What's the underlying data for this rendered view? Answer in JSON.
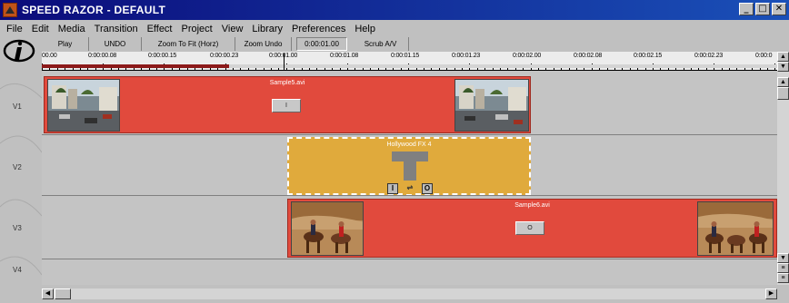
{
  "window": {
    "title": "SPEED RAZOR - DEFAULT",
    "controls": [
      "_",
      "□",
      "✕"
    ]
  },
  "menu": [
    "File",
    "Edit",
    "Media",
    "Transition",
    "Effect",
    "Project",
    "View",
    "Library",
    "Preferences",
    "Help"
  ],
  "toolbar": {
    "play": "Play",
    "undo": "UNDO",
    "zoom_fit": "Zoom To Fit (Horz)",
    "zoom_undo": "Zoom Undo",
    "timecode": "0:00:01.00",
    "scrub": "Scrub A/V"
  },
  "ruler": {
    "labels": [
      "00.00",
      "0:00:00.08",
      "0:00:00.15",
      "0:00:00.23",
      "0:00:01.00",
      "0:00:01.08",
      "0:00:01.15",
      "0:00:01.23",
      "0:00:02.00",
      "0:00:02.08",
      "0:00:02.15",
      "0:00:02.23",
      "0:00:0"
    ],
    "playhead": "0:00:01.00"
  },
  "tracks": [
    {
      "label": "V1"
    },
    {
      "label": "V2"
    },
    {
      "label": "V3"
    },
    {
      "label": "V4"
    }
  ],
  "clips": [
    {
      "name": "Sample5.avi",
      "marker": "I"
    },
    {
      "name": "Sample6.avi",
      "marker": "O"
    }
  ],
  "transition": {
    "name": "Hollywood FX 4",
    "in": "I",
    "out": "O",
    "swap": "⇌"
  },
  "colors": {
    "clip": "#e14a3d",
    "transition": "#e0aa3c",
    "titlebar": "#0b0b7a"
  }
}
